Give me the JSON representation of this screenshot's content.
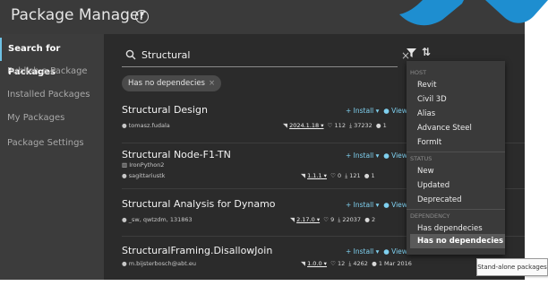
{
  "app": {
    "title": "Package Manager",
    "help_glyph": "?",
    "close_glyph": "✕"
  },
  "sidebar": {
    "items": [
      {
        "label": "Search for Packages",
        "active": true
      },
      {
        "label": "Publish a Package"
      },
      {
        "label": "Installed Packages"
      },
      {
        "label": "My Packages"
      },
      {
        "label": "Package Settings"
      }
    ]
  },
  "search": {
    "value": "Structural",
    "clear_glyph": "×",
    "sort_glyph": "⇅"
  },
  "active_filter": {
    "label": "Has no dependecies",
    "remove_glyph": "×"
  },
  "packages": [
    {
      "name": "Structural Design",
      "tag": "",
      "author": "tomasz.fudala",
      "install": "+ Install ▾",
      "view": "View",
      "version": "2024.1.18 ▾",
      "likes": "112",
      "downloads": "37232",
      "date": "1"
    },
    {
      "name": "Structural Node-F1-TN",
      "tag": "IronPython2",
      "author": "sagittariustk",
      "install": "+ Install ▾",
      "view": "View",
      "version": "1.1.1 ▾",
      "likes": "0",
      "downloads": "121",
      "date": "1"
    },
    {
      "name": "Structural Analysis for Dynamo",
      "tag": "",
      "author": "_sw, qwtzdm, 131863",
      "install": "+ Install ▾",
      "view": "View",
      "version": "2.17.0 ▾",
      "likes": "9",
      "downloads": "22037",
      "date": "2"
    },
    {
      "name": "StructuralFraming.DisallowJoin",
      "tag": "",
      "author": "m.bijsterbosch@abt.eu",
      "install": "+ Install ▾",
      "view": "View",
      "version": "1.0.0 ▾",
      "likes": "12",
      "downloads": "4262",
      "date": "1 Mar 2016"
    }
  ],
  "filter_menu": {
    "sections": [
      {
        "header": "HOST",
        "items": [
          "Revit",
          "Civil 3D",
          "Alias",
          "Advance Steel",
          "FormIt"
        ]
      },
      {
        "header": "STATUS",
        "items": [
          "New",
          "Updated",
          "Deprecated"
        ]
      },
      {
        "header": "DEPENDENCY",
        "items": [
          "Has dependecies",
          "Has no dependecies"
        ]
      }
    ],
    "selected": "Has no dependecies"
  },
  "tooltip": {
    "text": "Stand-alone packages"
  },
  "colors": {
    "accent": "#6ec1e4",
    "install": "#7fd0ef",
    "background": "#2b2b2b",
    "sidebar": "#3c3c3c",
    "menu": "#3a3a3a",
    "decoration": "#1e8ed0"
  },
  "icons": [
    "help-icon",
    "close-icon",
    "search-icon",
    "filter-icon",
    "sort-icon",
    "user-icon",
    "tag-icon",
    "version-icon",
    "heart-icon",
    "download-icon",
    "date-icon",
    "close-chip-icon"
  ]
}
